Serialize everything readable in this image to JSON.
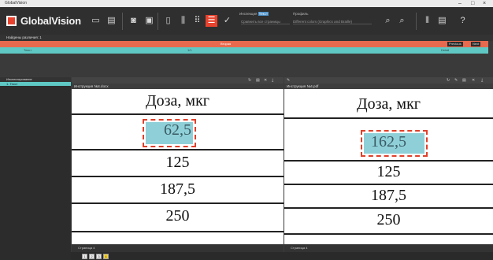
{
  "window": {
    "title": "GlobalVision",
    "minimize": "–",
    "maximize": "□",
    "close": "×"
  },
  "toolbar": {
    "logo_text": "GlobalVision",
    "options_label": "Инспекция",
    "options_highlight": "Текст",
    "profile_label": "Профиль",
    "compare_mode": "Сравнить все страницы",
    "profile_value": "Different colors (Graphics and Braille)"
  },
  "results": {
    "found_label": "Найдены различия: 1",
    "strip_center": "Вторая",
    "prev_label": "Previous",
    "next_label": "Next",
    "cyan_item": "Текст",
    "cyan_mid": "1/1",
    "cyan_right": "Detail"
  },
  "left_panel": {
    "header": "Инспектирование",
    "item": "1. Текст"
  },
  "left_doc": {
    "filename": "Инструкция №4.docx",
    "header": "Доза, мкг",
    "rows": [
      "62,5",
      "125",
      "187,5",
      "250"
    ],
    "page_label": "Страница 4"
  },
  "right_doc": {
    "filename": "Инструкция №4.pdf",
    "header": "Доза, мкг",
    "rows": [
      "162,5",
      "125",
      "187,5",
      "250"
    ],
    "page_label": "Страница 4"
  },
  "thumbnails": [
    "1",
    "2",
    "3",
    "4"
  ],
  "colors": {
    "accent": "#e8432e",
    "cyan": "#5fc8c4",
    "highlight": "#8fd0d8",
    "dashed": "#e0402a"
  }
}
